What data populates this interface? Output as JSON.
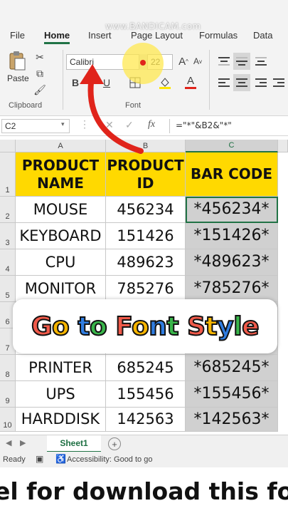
{
  "watermark": "www.BANDICAM.com",
  "ribbon": {
    "tabs": [
      "File",
      "Home",
      "Insert",
      "Page Layout",
      "Formulas",
      "Data"
    ],
    "active_tab": "Home",
    "clipboard": {
      "paste_label": "Paste",
      "group_label": "Clipboard"
    },
    "font": {
      "name": "Calibri",
      "size": "22",
      "group_label": "Font",
      "grow": "A",
      "shrink": "A"
    }
  },
  "formula_bar": {
    "name_box": "C2",
    "fx": "fx",
    "formula": "=\"*\"&B2&\"*\""
  },
  "grid": {
    "columns": [
      "A",
      "B",
      "C"
    ],
    "rows": [
      "1",
      "2",
      "3",
      "4",
      "5",
      "6",
      "7",
      "8",
      "9",
      "10"
    ],
    "header": [
      "PRODUCT NAME",
      "PRODUCT ID",
      "BAR CODE"
    ],
    "data": [
      [
        "MOUSE",
        "456234",
        "*456234*"
      ],
      [
        "KEYBOARD",
        "151426",
        "*151426*"
      ],
      [
        "CPU",
        "489623",
        "*489623*"
      ],
      [
        "MONITOR",
        "785276",
        "*785276*"
      ],
      [
        "",
        "",
        ""
      ],
      [
        "",
        "",
        ""
      ],
      [
        "PRINTER",
        "685245",
        "*685245*"
      ],
      [
        "UPS",
        "155456",
        "*155456*"
      ],
      [
        "HARDDISK",
        "142563",
        "*142563*"
      ]
    ]
  },
  "overlay": {
    "text": "Go to Font Style",
    "colors": [
      "#f05a4a",
      "#f7b500",
      "#2f7de1",
      "#39b54a"
    ]
  },
  "sheetbar": {
    "sheet_name": "Sheet1",
    "add_label": "+"
  },
  "statusbar": {
    "ready": "Ready",
    "accessibility": "Accessibility: Good to go"
  },
  "bottom_caption": "el for download this font"
}
